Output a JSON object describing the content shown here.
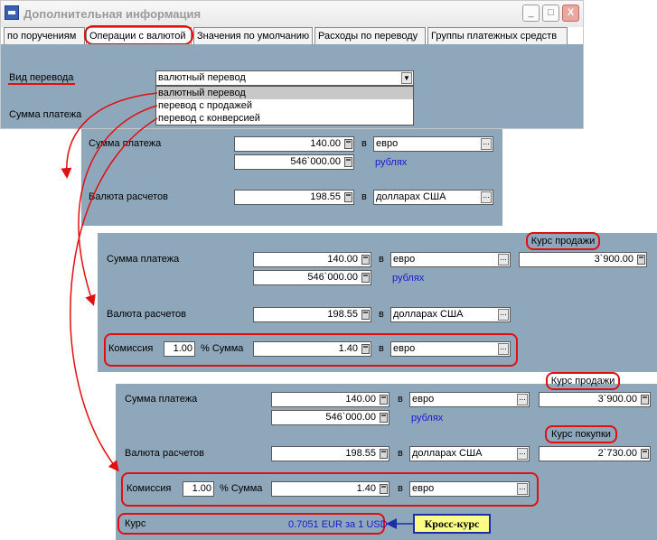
{
  "window": {
    "title": "Дополнительная информация",
    "controls": {
      "minimize": "_",
      "maximize": "□",
      "close": "X"
    }
  },
  "tabs": [
    "по поручениям",
    "Операции с валютой",
    "Значения по умолчанию",
    "Расходы по переводу",
    "Группы платежных средств"
  ],
  "top": {
    "transfer_type_label": "Вид перевода",
    "transfer_type_value": "валютный перевод",
    "options": [
      "валютный перевод",
      "перевод с продажей",
      "перевод с конверсией"
    ],
    "payment_sum_label": "Сумма платежа"
  },
  "panel1": {
    "payment_label": "Сумма платежа",
    "amount": "140.00",
    "in": "в",
    "currency": "евро",
    "amount_rub": "546`000.00",
    "rub_text": "рублях",
    "settlement_label": "Валюта расчетов",
    "settlement_amount": "198.55",
    "settlement_currency": "долларах США"
  },
  "panel2": {
    "payment_label": "Сумма платежа",
    "amount": "140.00",
    "in": "в",
    "currency": "евро",
    "amount_rub": "546`000.00",
    "rub_text": "рублях",
    "sell_rate_label": "Курс продажи",
    "sell_rate": "3`900.00",
    "settlement_label": "Валюта расчетов",
    "settlement_amount": "198.55",
    "settlement_currency": "долларах США",
    "commission_label": "Комиссия",
    "commission_pct": "1.00",
    "pct_sum_label": "% Сумма",
    "commission_amount": "1.40",
    "commission_currency": "евро"
  },
  "panel3": {
    "payment_label": "Сумма платежа",
    "amount": "140.00",
    "in": "в",
    "currency": "евро",
    "amount_rub": "546`000.00",
    "rub_text": "рублях",
    "sell_rate_label": "Курс продажи",
    "sell_rate": "3`900.00",
    "buy_rate_label": "Курс покупки",
    "buy_rate": "2`730.00",
    "settlement_label": "Валюта расчетов",
    "settlement_amount": "198.55",
    "settlement_currency": "долларах США",
    "commission_label": "Комиссия",
    "commission_pct": "1.00",
    "pct_sum_label": "% Сумма",
    "commission_amount": "1.40",
    "commission_currency": "евро",
    "rate_label": "Курс",
    "rate_value": "0.7051 EUR за 1 USD",
    "cross_rate_note": "Кросс-курс"
  },
  "colors": {
    "panel": "#8ea7bb",
    "highlight": "#e01010",
    "link_blue": "#1b1bcc",
    "note_bg": "#ffff88",
    "note_border": "#1a2fa8"
  }
}
